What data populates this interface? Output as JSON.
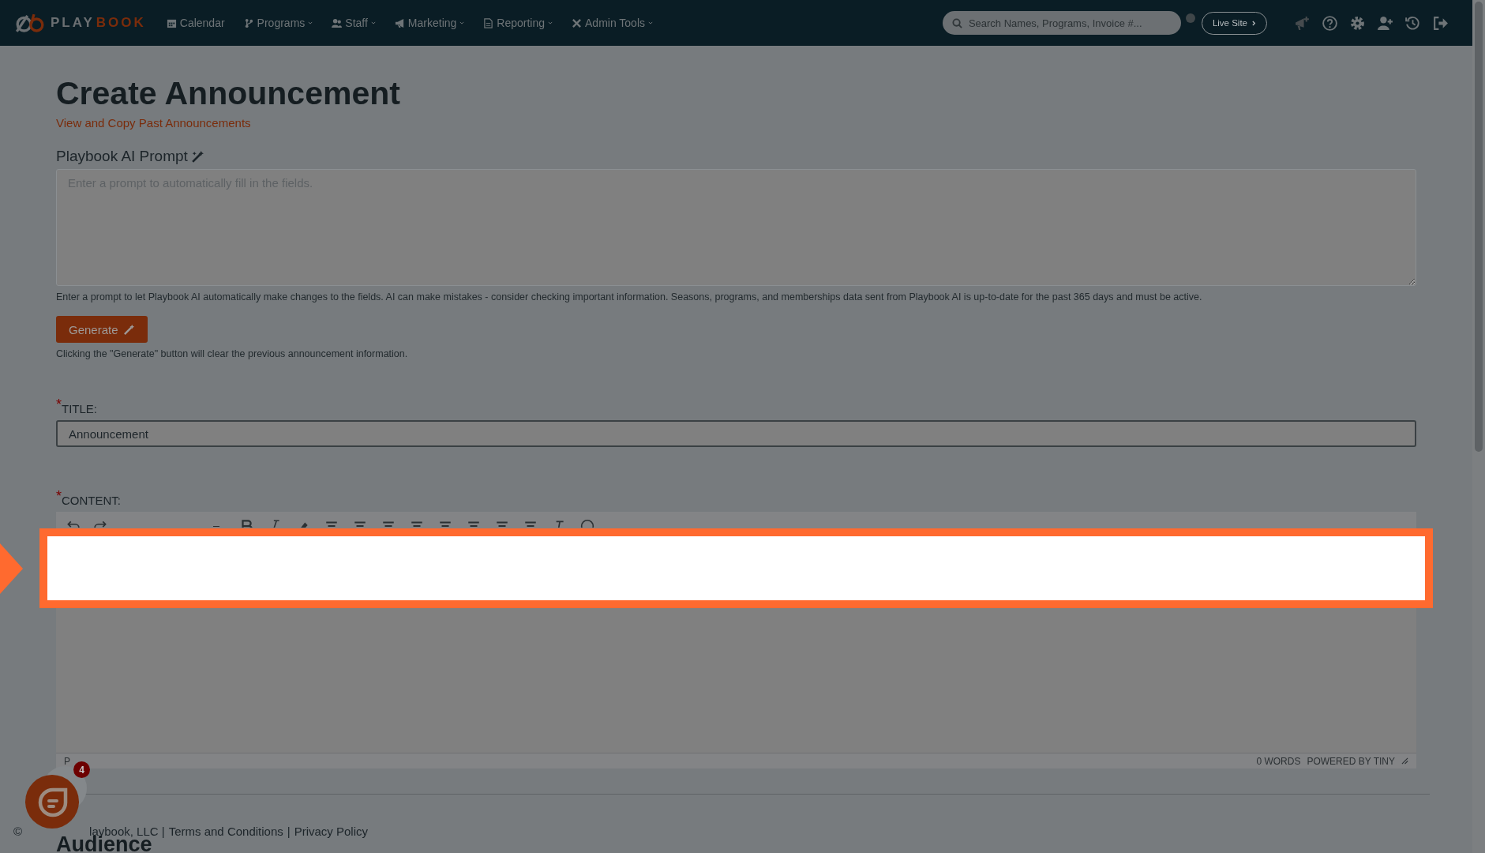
{
  "nav": {
    "logo": {
      "part_1": "PLAY",
      "part_2": "BOOK"
    },
    "items": [
      {
        "label": "Calendar",
        "dropdown": false
      },
      {
        "label": "Programs",
        "dropdown": true
      },
      {
        "label": "Staff",
        "dropdown": true
      },
      {
        "label": "Marketing",
        "dropdown": true
      },
      {
        "label": "Reporting",
        "dropdown": true
      },
      {
        "label": "Admin Tools",
        "dropdown": true
      }
    ],
    "search": {
      "placeholder": "Search Names, Programs, Invoice #..."
    },
    "live_site": "Live Site"
  },
  "page": {
    "title": "Create Announcement",
    "link": "View and Copy Past Announcements"
  },
  "ai_prompt": {
    "label": "Playbook AI Prompt",
    "placeholder": "Enter a prompt to automatically fill in the fields.",
    "help": "Enter a prompt to let Playbook AI automatically make changes to the fields. AI can make mistakes - consider checking important information. Seasons, programs, and memberships data sent from Playbook AI is up-to-date for the past 365 days and must be active.",
    "button": "Generate",
    "note": "Clicking the \"Generate\" button will clear the previous announcement information."
  },
  "title_field": {
    "mark": "*",
    "label": "TITLE:",
    "value": "Announcement"
  },
  "content": {
    "mark": "*",
    "label": "CONTENT:",
    "toolbar": [
      {
        "kind": "icon"
      },
      {
        "kind": "icon"
      },
      {
        "kind": "select"
      },
      {
        "kind": "icon"
      },
      {
        "kind": "icon"
      },
      {
        "kind": "icon"
      },
      {
        "kind": "icon"
      },
      {
        "kind": "icon"
      },
      {
        "kind": "icon"
      },
      {
        "kind": "icon"
      },
      {
        "kind": "icon"
      },
      {
        "kind": "icon"
      },
      {
        "kind": "icon"
      },
      {
        "kind": "icon"
      },
      {
        "kind": "icon"
      },
      {
        "kind": "icon"
      }
    ],
    "path": "P",
    "word_count": "0 WORDS",
    "branding": "POWERED BY TINY"
  },
  "chat": {
    "badge": "4"
  },
  "footer": [
    "©",
    "laybook, LLC |",
    "Terms and Conditions",
    "|",
    "Privacy Policy"
  ],
  "next_section": "Audience"
}
